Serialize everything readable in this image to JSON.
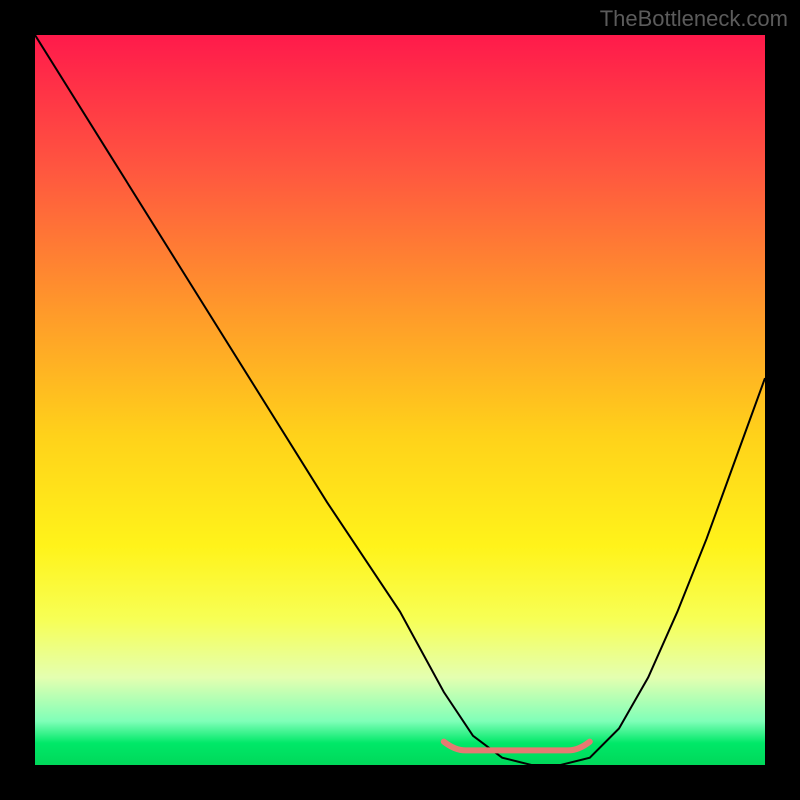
{
  "watermark": "TheBottleneck.com",
  "chart_data": {
    "type": "line",
    "title": "",
    "xlabel": "",
    "ylabel": "",
    "xlim": [
      0,
      100
    ],
    "ylim": [
      0,
      100
    ],
    "grid": false,
    "legend": false,
    "series": [
      {
        "name": "bottleneck-curve",
        "x": [
          0,
          10,
          20,
          30,
          40,
          50,
          56,
          60,
          64,
          68,
          72,
          76,
          80,
          84,
          88,
          92,
          96,
          100
        ],
        "values": [
          100,
          84,
          68,
          52,
          36,
          21,
          10,
          4,
          1,
          0,
          0,
          1,
          5,
          12,
          21,
          31,
          42,
          53
        ]
      }
    ],
    "optimal_marker": {
      "x_start": 56,
      "x_end": 76,
      "y": 2,
      "color": "#e67a72"
    },
    "gradient_stops": [
      {
        "pos": 0.0,
        "color": "#ff1a4b"
      },
      {
        "pos": 0.18,
        "color": "#ff5540"
      },
      {
        "pos": 0.38,
        "color": "#ff9a2a"
      },
      {
        "pos": 0.55,
        "color": "#ffd21a"
      },
      {
        "pos": 0.7,
        "color": "#fff31a"
      },
      {
        "pos": 0.8,
        "color": "#f7ff55"
      },
      {
        "pos": 0.88,
        "color": "#e4ffb0"
      },
      {
        "pos": 0.94,
        "color": "#7fffb8"
      },
      {
        "pos": 0.97,
        "color": "#00e868"
      },
      {
        "pos": 1.0,
        "color": "#00d85a"
      }
    ]
  }
}
